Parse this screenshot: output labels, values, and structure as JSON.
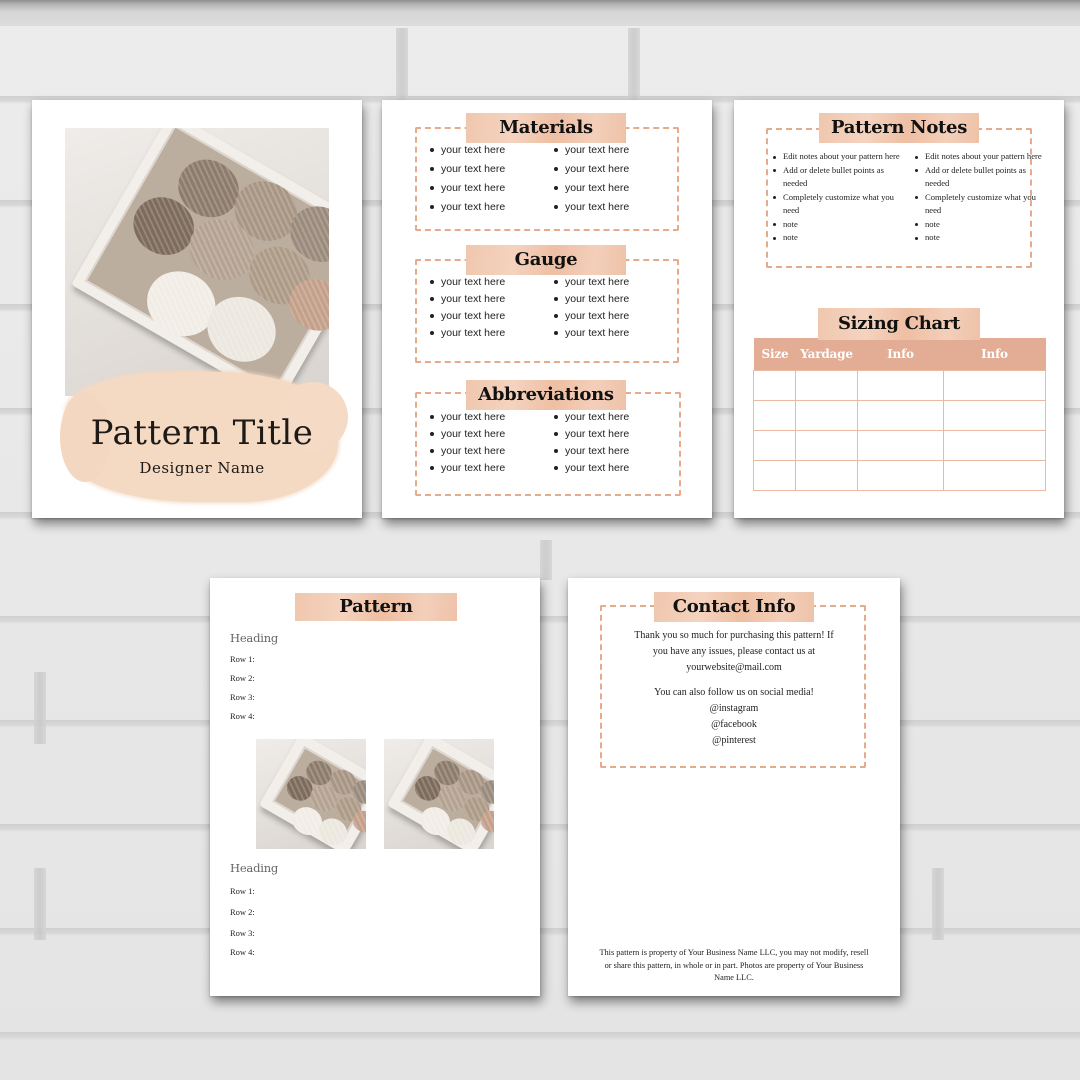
{
  "cover": {
    "title": "Pattern Title",
    "designer": "Designer Name",
    "photo": "yarn-basket-photo"
  },
  "materials_page": {
    "sections": [
      {
        "title": "Materials",
        "left": [
          "your text here",
          "your text here",
          "your text here",
          "your text here"
        ],
        "right": [
          "your text here",
          "your text here",
          "your text here",
          "your text here"
        ]
      },
      {
        "title": "Gauge",
        "left": [
          "your text here",
          "your text here",
          "your text here",
          "your text here"
        ],
        "right": [
          "your text here",
          "your text here",
          "your text here",
          "your text here"
        ]
      },
      {
        "title": "Abbreviations",
        "left": [
          "your text here",
          "your text here",
          "your text here",
          "your text here"
        ],
        "right": [
          "your text here",
          "your text here",
          "your text here",
          "your text here"
        ]
      }
    ]
  },
  "notes_page": {
    "notes_title": "Pattern Notes",
    "notes_left": [
      "Edit notes about your pattern here",
      "Add or delete bullet points as needed",
      "Completely customize what you need",
      "note",
      "note"
    ],
    "notes_right": [
      "Edit notes about your pattern here",
      "Add or delete bullet points as needed",
      "Completely customize what you need",
      "note",
      "note"
    ],
    "sizing_title": "Sizing Chart",
    "sizing_headers": [
      "Size",
      "Yardage",
      "Info",
      "Info"
    ],
    "sizing_rows": 4
  },
  "pattern_page": {
    "title": "Pattern",
    "blocks": [
      {
        "heading": "Heading",
        "rows": [
          "Row 1:",
          "Row 2:",
          "Row 3:",
          "Row 4:"
        ]
      },
      {
        "heading": "Heading",
        "rows": [
          "Row 1:",
          "Row 2:",
          "Row 3:",
          "Row 4:"
        ]
      }
    ]
  },
  "contact_page": {
    "title": "Contact Info",
    "thanks_lines": [
      "Thank you so much for purchasing this pattern! If",
      "you have any issues, please contact us at",
      "yourwebsite@mail.com"
    ],
    "social_lines": [
      "You can also follow us on social media!",
      "@instagram",
      "@facebook",
      "@pinterest"
    ],
    "legal_lines": [
      "This pattern is property of Your Business Name LLC, you may not modify, resell",
      "or share this pattern, in whole or in part. Photos are property of Your Business",
      "Name LLC."
    ]
  },
  "colors": {
    "accent_peach": "#e2ad94",
    "tape": "#f0c7ae",
    "dash": "#e6ab8c",
    "brush": "#f4d9c3"
  }
}
